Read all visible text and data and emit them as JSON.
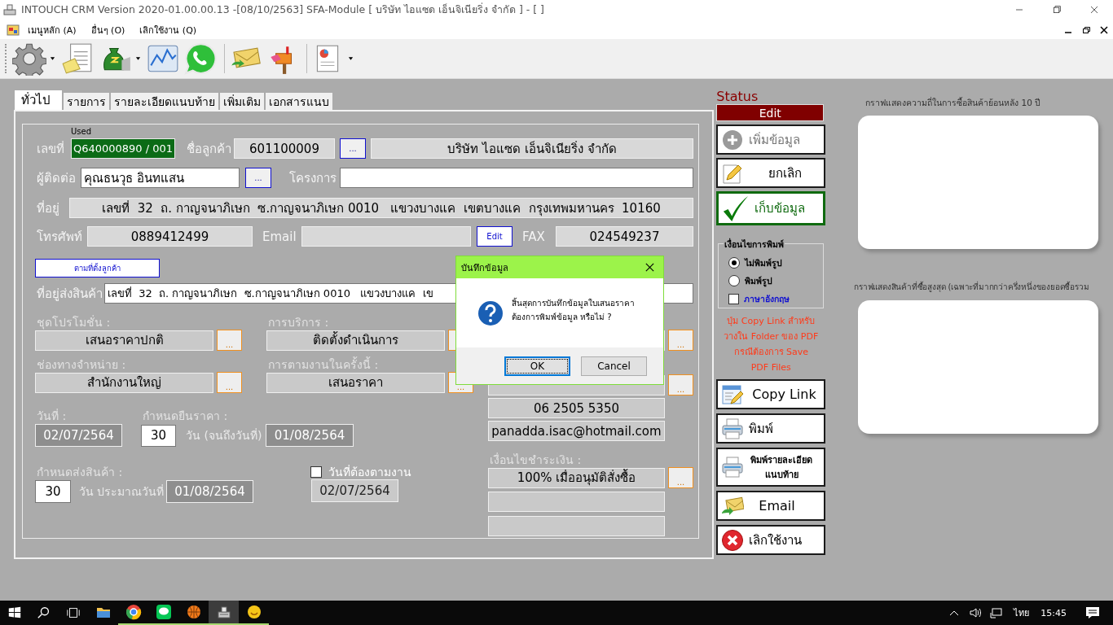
{
  "window": {
    "title": "INTOUCH CRM Version 2020-01.00.00.13 -[08/10/2563] SFA-Module  [ บริษัท ไอแซด เอ็นจิเนียริ่ง จำกัด ] - [ ]"
  },
  "menu": [
    "เมนูหลัก (A)",
    "อื่นๆ (O)",
    "เลิกใช้งาน (Q)"
  ],
  "toolbar": [
    {
      "kind": "gear",
      "dropdown": true
    },
    {
      "kind": "document",
      "dropdown": false
    },
    {
      "kind": "money",
      "dropdown": true
    },
    {
      "kind": "chart",
      "dropdown": false
    },
    {
      "kind": "phone",
      "dropdown": false
    },
    {
      "kind": "envelope",
      "dropdown": false
    },
    {
      "kind": "mailbox",
      "dropdown": false
    },
    {
      "kind": "report",
      "dropdown": true
    }
  ],
  "tabs": [
    {
      "label": "ทั่วไป",
      "selected": true
    },
    {
      "label": "รายการ",
      "selected": false
    },
    {
      "label": "รายละเอียดแนบท้าย",
      "selected": false
    },
    {
      "label": "เพิ่มเติม",
      "selected": false
    },
    {
      "label": "เอกสารแนบ",
      "selected": false
    }
  ],
  "form": {
    "doc_no": {
      "label": "เลขที่",
      "badge": "Used",
      "value": "Q640000890 / 001"
    },
    "customer": {
      "label": "ชื่อลูกค้า",
      "code": "601100009",
      "lookup": "...",
      "name": "บริษัท ไอแซด เอ็นจิเนียริ่ง จำกัด"
    },
    "contact": {
      "label": "ผู้ติดต่อ",
      "value": "คุณธนวุธ อินทแสน",
      "lookup": "..."
    },
    "project": {
      "label": "โครงการ"
    },
    "address": {
      "label": "ที่อยู่",
      "value": "เลขที่  32  ถ. กาญจนาภิเษก  ซ.กาญจนาภิเษก 0010   แขวงบางแค  เขตบางแค  กรุงเทพมหานคร  10160"
    },
    "phone": {
      "label": "โทรศัพท์",
      "value": "0889412499"
    },
    "email": {
      "label": "Email",
      "edit": "Edit"
    },
    "fax": {
      "label": "FAX",
      "value": "024549237"
    },
    "same_address": "ตามที่ตั้งลูกค้า",
    "ship_address": {
      "label": "ที่อยู่ส่งสินค้า",
      "value": "เลขที่  32  ถ. กาญจนาภิเษก  ซ.กาญจนาภิเษก 0010   แขวงบางแค  เข"
    },
    "promo": {
      "label": "ชุดโปรโมชั่น :",
      "value": "เสนอราคาปกติ",
      "lookup": "..."
    },
    "service": {
      "label": "การบริการ :",
      "value": "ติดตั้งดำเนินการ"
    },
    "channel": {
      "label": "ช่องทางจำหน่าย  :",
      "value": "สำนักงานใหญ่",
      "lookup": "..."
    },
    "followup": {
      "label": "การตามงานในครั้งนี้ :",
      "value": "เสนอราคา",
      "lookup": "..."
    },
    "date": {
      "label": "วันที่ :",
      "value": "02/07/2564"
    },
    "validity": {
      "label": "กำหนดยืนราคา :",
      "days": "30",
      "unit": "วัน (จนถึงวันที่)",
      "until": "01/08/2564"
    },
    "delivery": {
      "label": "กำหนดส่งสินค้า :",
      "days": "30",
      "unit": "วัน ประมาณวันที่",
      "date": "01/08/2564"
    },
    "follow_date": {
      "label": "วันที่ต้องตามงาน",
      "checked": false,
      "date": "02/07/2564"
    },
    "right_top_lookup": "...",
    "sales_lookup": "...",
    "sales_phone": "06 2505 5350",
    "sales_email": "panadda.isac@hotmail.com",
    "payment": {
      "label": "เงื่อนไขชำระเงิน :",
      "value": "100% เมื่ออนุมัติสั่งซื้อ",
      "lookup": "..."
    }
  },
  "status": {
    "label": "Status",
    "value": "Edit"
  },
  "actions_top": [
    {
      "label": "เพิ่มข้อมูล",
      "kind": "add",
      "disabled": true
    },
    {
      "label": "ยกเลิก",
      "kind": "cancel",
      "disabled": false
    },
    {
      "label": "เก็บข้อมูล",
      "kind": "save",
      "disabled": false
    }
  ],
  "print_options": {
    "title": "เงื่อนไขการพิมพ์",
    "radios": [
      {
        "label": "ไม่พิมพ์รูป",
        "selected": true
      },
      {
        "label": "พิมพ์รูป",
        "selected": false
      }
    ],
    "english": {
      "label": "ภาษาอังกฤษ",
      "checked": false
    }
  },
  "note": "ปุ่ม Copy Link สำหรับ\nวางใน Folder ของ PDF\nกรณีต้องการ Save\nPDF Files",
  "actions_bottom": [
    {
      "label": "Copy Link",
      "kind": "copy"
    },
    {
      "label": "พิมพ์",
      "kind": "print"
    },
    {
      "label": "พิมพ์รายละเอียดแนบท้าย",
      "kind": "print_small"
    },
    {
      "label": "Email",
      "kind": "email"
    },
    {
      "label": "เลิกใช้งาน",
      "kind": "exit"
    }
  ],
  "charts": [
    {
      "title": "กราฟแสดงความถี่ในการซื้อสินค้าย้อนหลัง 10 ปี"
    },
    {
      "title": "กราฟแสดงสินค้าที่ซื้อสูงสุด (เฉพาะที่มากกว่าครึ่งหนึ่งของยอดซื้อรวม"
    }
  ],
  "dialog": {
    "title": "บันทึกข้อมูล",
    "message": "สิ้นสุดการบันทึกข้อมูลใบเสนอราคา\nต้องการพิมพ์ข้อมูล หรือไม่ ?",
    "buttons": [
      {
        "label": "OK",
        "selected": true
      },
      {
        "label": "Cancel",
        "selected": false
      }
    ]
  },
  "taskbar": {
    "apps": [
      {
        "kind": "folder",
        "running": false,
        "selected": false
      },
      {
        "kind": "chrome",
        "running": true,
        "selected": false
      },
      {
        "kind": "chat",
        "running": true,
        "selected": false
      },
      {
        "kind": "ball",
        "running": true,
        "selected": false
      },
      {
        "kind": "intouch",
        "running": true,
        "selected": true
      },
      {
        "kind": "smile",
        "running": true,
        "selected": false
      }
    ],
    "language": "ไทย",
    "time": "15:45"
  }
}
